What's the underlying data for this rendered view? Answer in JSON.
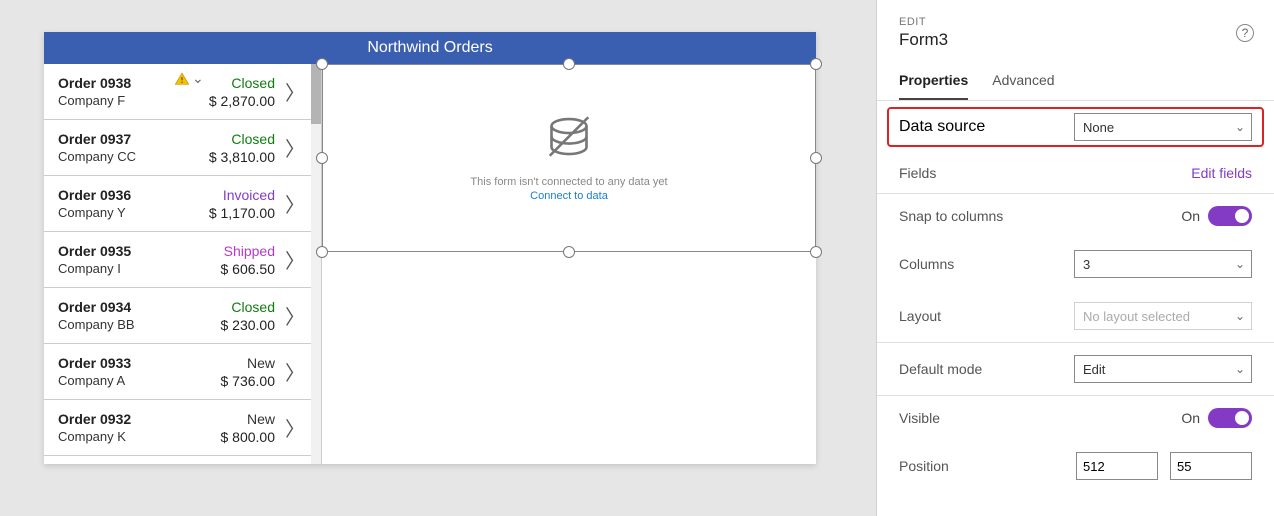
{
  "app": {
    "title": "Northwind Orders"
  },
  "orders": [
    {
      "num": "Order 0938",
      "company": "Company F",
      "status": "Closed",
      "amount": "$ 2,870.00",
      "warn": true
    },
    {
      "num": "Order 0937",
      "company": "Company CC",
      "status": "Closed",
      "amount": "$ 3,810.00",
      "warn": false
    },
    {
      "num": "Order 0936",
      "company": "Company Y",
      "status": "Invoiced",
      "amount": "$ 1,170.00",
      "warn": false
    },
    {
      "num": "Order 0935",
      "company": "Company I",
      "status": "Shipped",
      "amount": "$ 606.50",
      "warn": false
    },
    {
      "num": "Order 0934",
      "company": "Company BB",
      "status": "Closed",
      "amount": "$ 230.00",
      "warn": false
    },
    {
      "num": "Order 0933",
      "company": "Company A",
      "status": "New",
      "amount": "$ 736.00",
      "warn": false
    },
    {
      "num": "Order 0932",
      "company": "Company K",
      "status": "New",
      "amount": "$ 800.00",
      "warn": false
    }
  ],
  "emptyForm": {
    "line1": "This form isn't connected to any data yet",
    "line2": "Connect to data"
  },
  "panel": {
    "editLabel": "EDIT",
    "name": "Form3",
    "tabs": {
      "properties": "Properties",
      "advanced": "Advanced"
    },
    "dataSource": {
      "label": "Data source",
      "value": "None"
    },
    "fields": {
      "label": "Fields",
      "link": "Edit fields"
    },
    "snap": {
      "label": "Snap to columns",
      "stateText": "On"
    },
    "columns": {
      "label": "Columns",
      "value": "3"
    },
    "layout": {
      "label": "Layout",
      "value": "No layout selected"
    },
    "defaultMode": {
      "label": "Default mode",
      "value": "Edit"
    },
    "visible": {
      "label": "Visible",
      "stateText": "On"
    },
    "position": {
      "label": "Position",
      "x": "512",
      "y": "55"
    }
  }
}
